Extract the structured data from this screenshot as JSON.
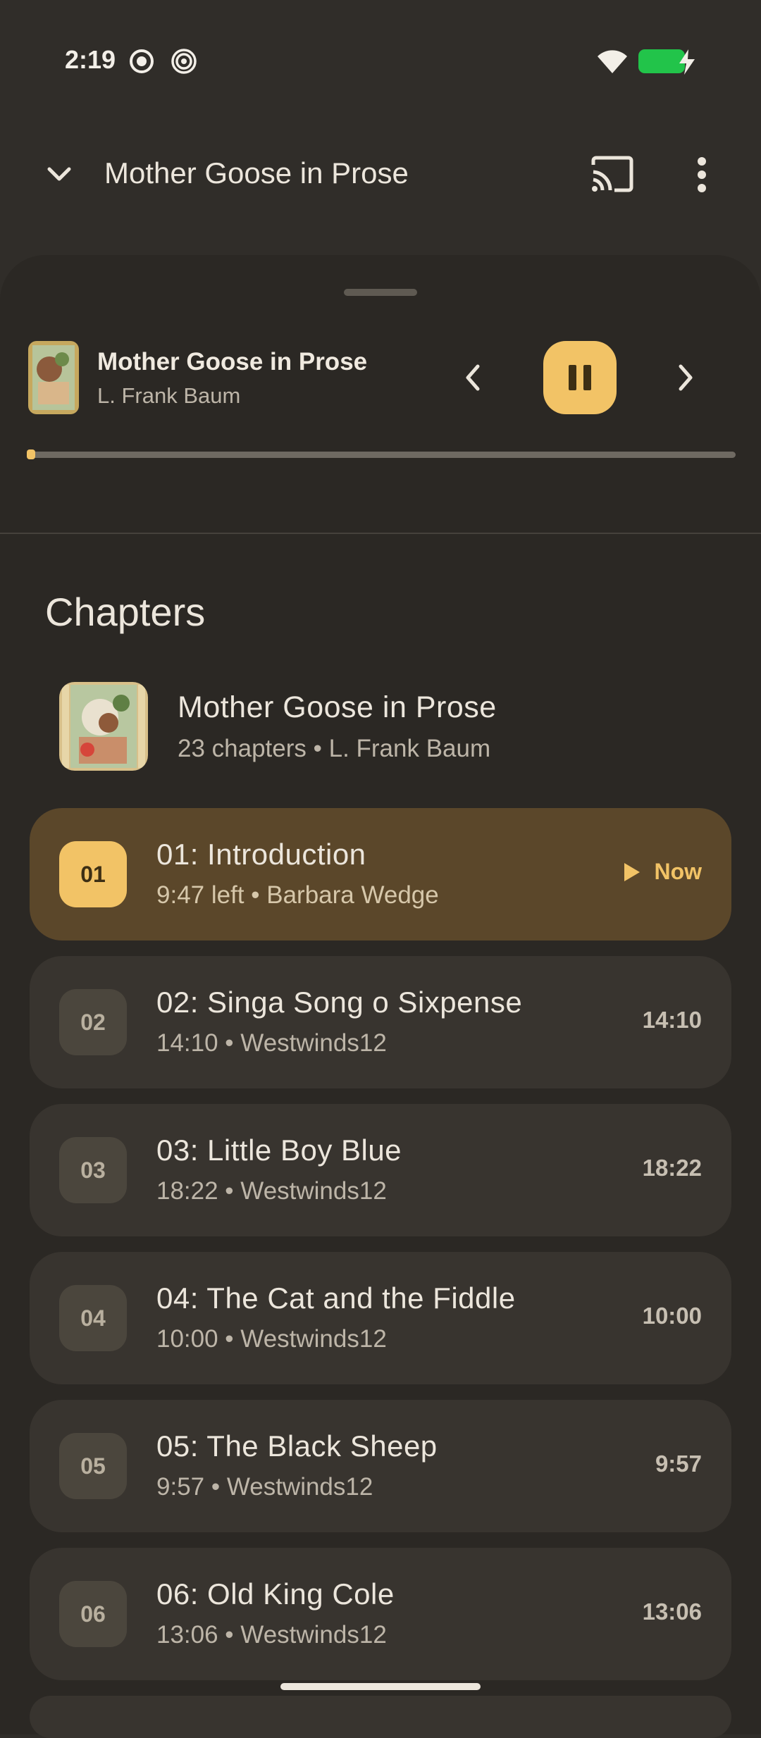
{
  "status_bar": {
    "time": "2:19"
  },
  "app_bar": {
    "title": "Mother Goose in Prose"
  },
  "player": {
    "title": "Mother Goose in Prose",
    "author": "L. Frank Baum",
    "progress_fraction": 0.006,
    "accent_color": "#f2c366"
  },
  "chapters_section": {
    "heading": "Chapters",
    "book_title": "Mother Goose in Prose",
    "book_subtitle": "23 chapters • L. Frank Baum"
  },
  "chapters": [
    {
      "num": "01",
      "title": "01: Introduction",
      "meta": "9:47 left • Barbara Wedge",
      "right": "Now",
      "current": true
    },
    {
      "num": "02",
      "title": "02: Singa Song o Sixpense",
      "meta": "14:10 • Westwinds12",
      "right": "14:10",
      "current": false
    },
    {
      "num": "03",
      "title": "03: Little Boy Blue",
      "meta": "18:22 • Westwinds12",
      "right": "18:22",
      "current": false
    },
    {
      "num": "04",
      "title": "04: The Cat and the Fiddle",
      "meta": "10:00 • Westwinds12",
      "right": "10:00",
      "current": false
    },
    {
      "num": "05",
      "title": "05: The Black Sheep",
      "meta": "9:57 • Westwinds12",
      "right": "9:57",
      "current": false
    },
    {
      "num": "06",
      "title": "06: Old King Cole",
      "meta": "13:06 • Westwinds12",
      "right": "13:06",
      "current": false
    }
  ]
}
